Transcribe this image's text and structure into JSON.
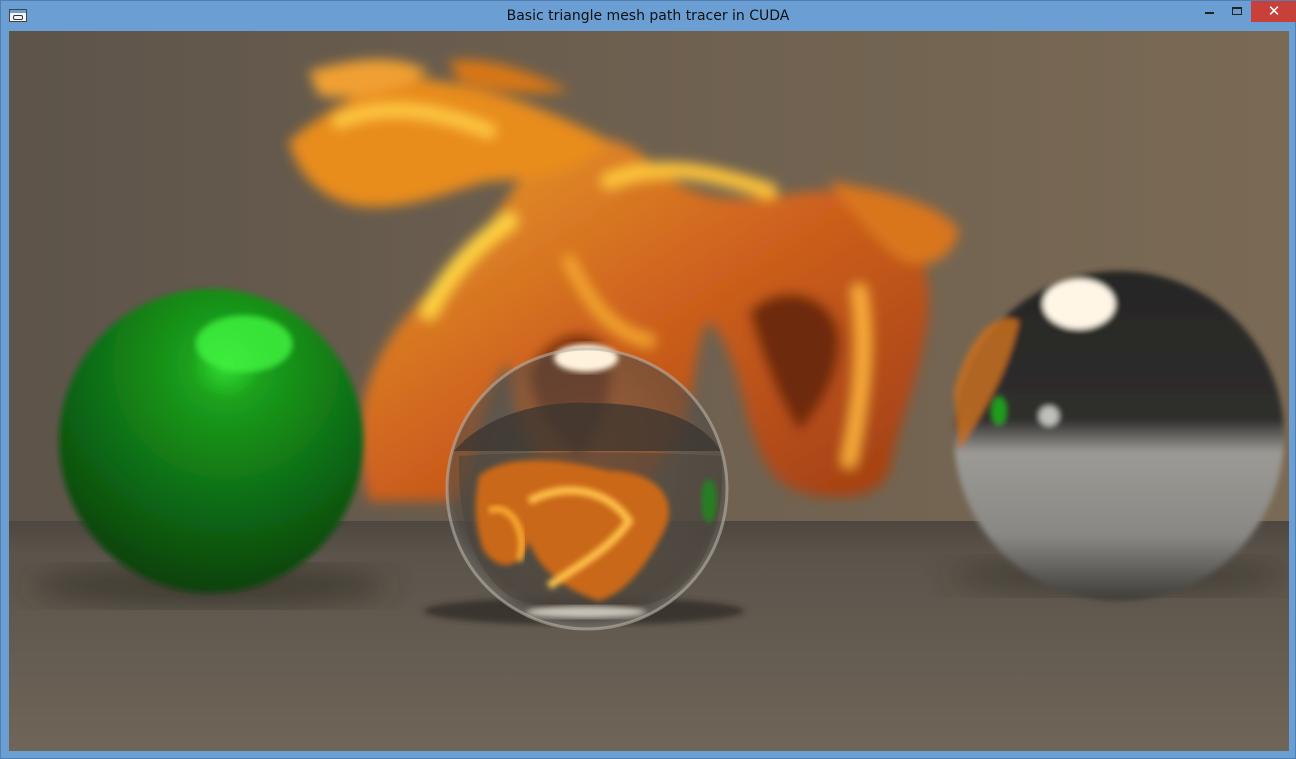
{
  "window": {
    "title": "Basic triangle mesh path tracer in CUDA",
    "app_icon": "console-window-icon",
    "controls": {
      "minimize": "minimize-icon",
      "maximize": "maximize-icon",
      "close_glyph": "✕"
    }
  },
  "render": {
    "objects": [
      "dragon",
      "green-sphere",
      "glass-sphere",
      "chrome-sphere",
      "floor"
    ],
    "colors": {
      "background": "#5e5246",
      "floor": "#6e6454",
      "dragon": "#e0861c",
      "green_sphere": "#1a7a1a",
      "chrome_sphere": "#8c8c8c"
    }
  }
}
